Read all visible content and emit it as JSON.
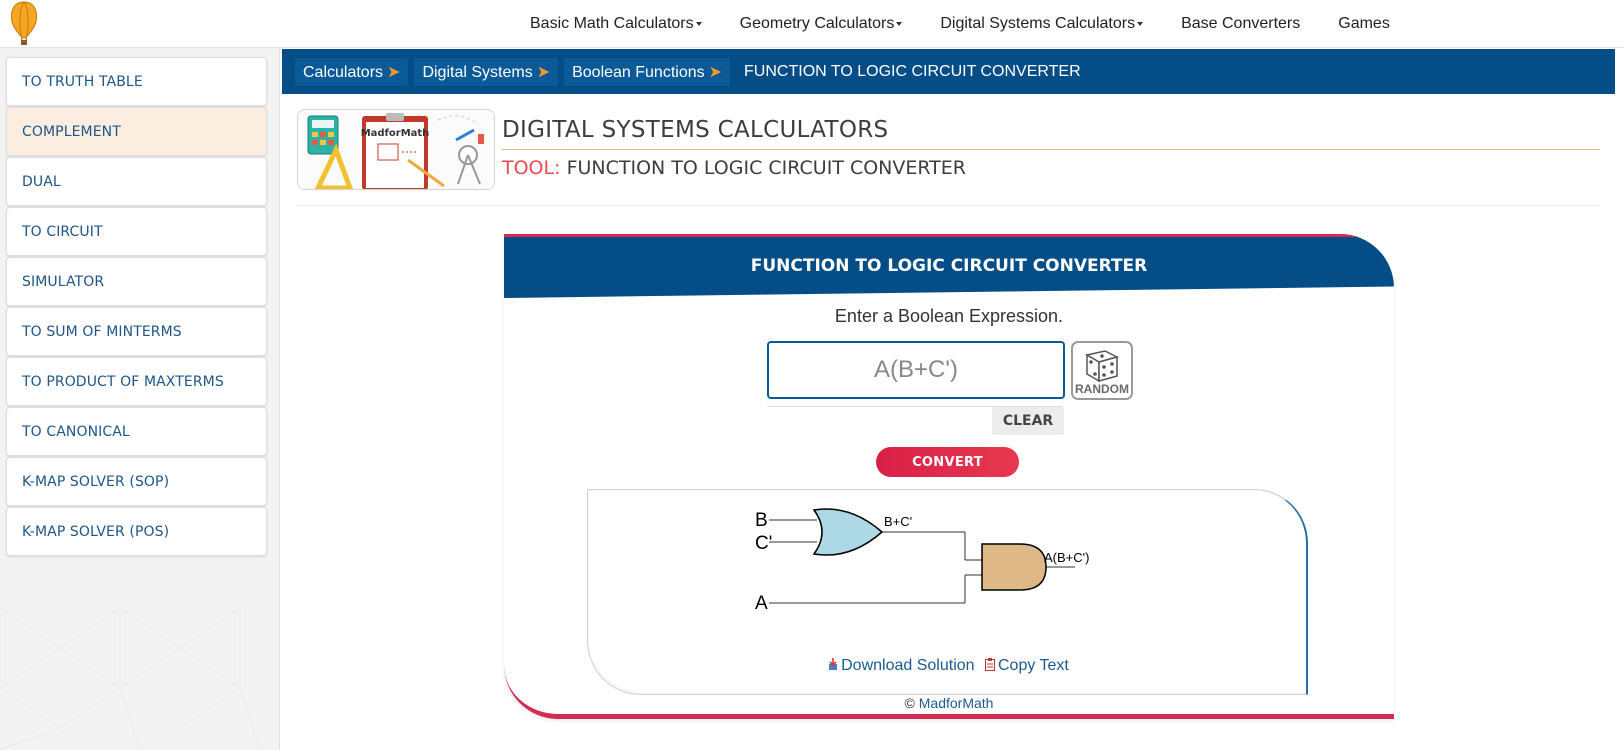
{
  "topnav": {
    "items": [
      {
        "label": "Basic Math Calculators"
      },
      {
        "label": "Geometry Calculators"
      },
      {
        "label": "Digital Systems Calculators"
      },
      {
        "label": "Base Converters"
      },
      {
        "label": "Games"
      }
    ]
  },
  "sidebar": {
    "items": [
      {
        "label": "TO TRUTH TABLE"
      },
      {
        "label": "COMPLEMENT",
        "active": true
      },
      {
        "label": "DUAL"
      },
      {
        "label": "TO CIRCUIT"
      },
      {
        "label": "SIMULATOR"
      },
      {
        "label": "TO SUM OF MINTERMS"
      },
      {
        "label": "TO PRODUCT OF MAXTERMS"
      },
      {
        "label": "TO CANONICAL"
      },
      {
        "label": "K-MAP SOLVER (SOP)"
      },
      {
        "label": "K-MAP SOLVER (POS)"
      }
    ]
  },
  "breadcrumb": {
    "items": [
      "Calculators",
      "Digital Systems",
      "Boolean Functions"
    ],
    "arrow": "➤",
    "current": "FUNCTION TO LOGIC CIRCUIT CONVERTER"
  },
  "header": {
    "banner_text": "MadforMath",
    "title": "DIGITAL SYSTEMS CALCULATORS",
    "tool_label": "TOOL:",
    "tool_name": "FUNCTION TO LOGIC CIRCUIT CONVERTER"
  },
  "tool": {
    "title": "FUNCTION TO LOGIC CIRCUIT CONVERTER",
    "prompt": "Enter a Boolean Expression.",
    "input_placeholder": "A(B+C')",
    "input_value": "",
    "random_label": "RANDOM",
    "clear_label": "CLEAR",
    "convert_label": "CONVERT"
  },
  "circuit": {
    "inputs": [
      "B",
      "C'",
      "A"
    ],
    "or_output": "B+C'",
    "and_output": "A(B+C')"
  },
  "result_links": {
    "download": "Download Solution",
    "copy": "Copy Text"
  },
  "footer": {
    "copyright": "©",
    "brand": "MadforMath"
  },
  "colors": {
    "primary": "#054d86",
    "accent": "#d32c50",
    "crumb_arrow": "#f2992e",
    "tool_label": "#ea4b55",
    "or_gate": "#add8e6",
    "and_gate": "#deb887",
    "active_item": "#fbeee0"
  }
}
